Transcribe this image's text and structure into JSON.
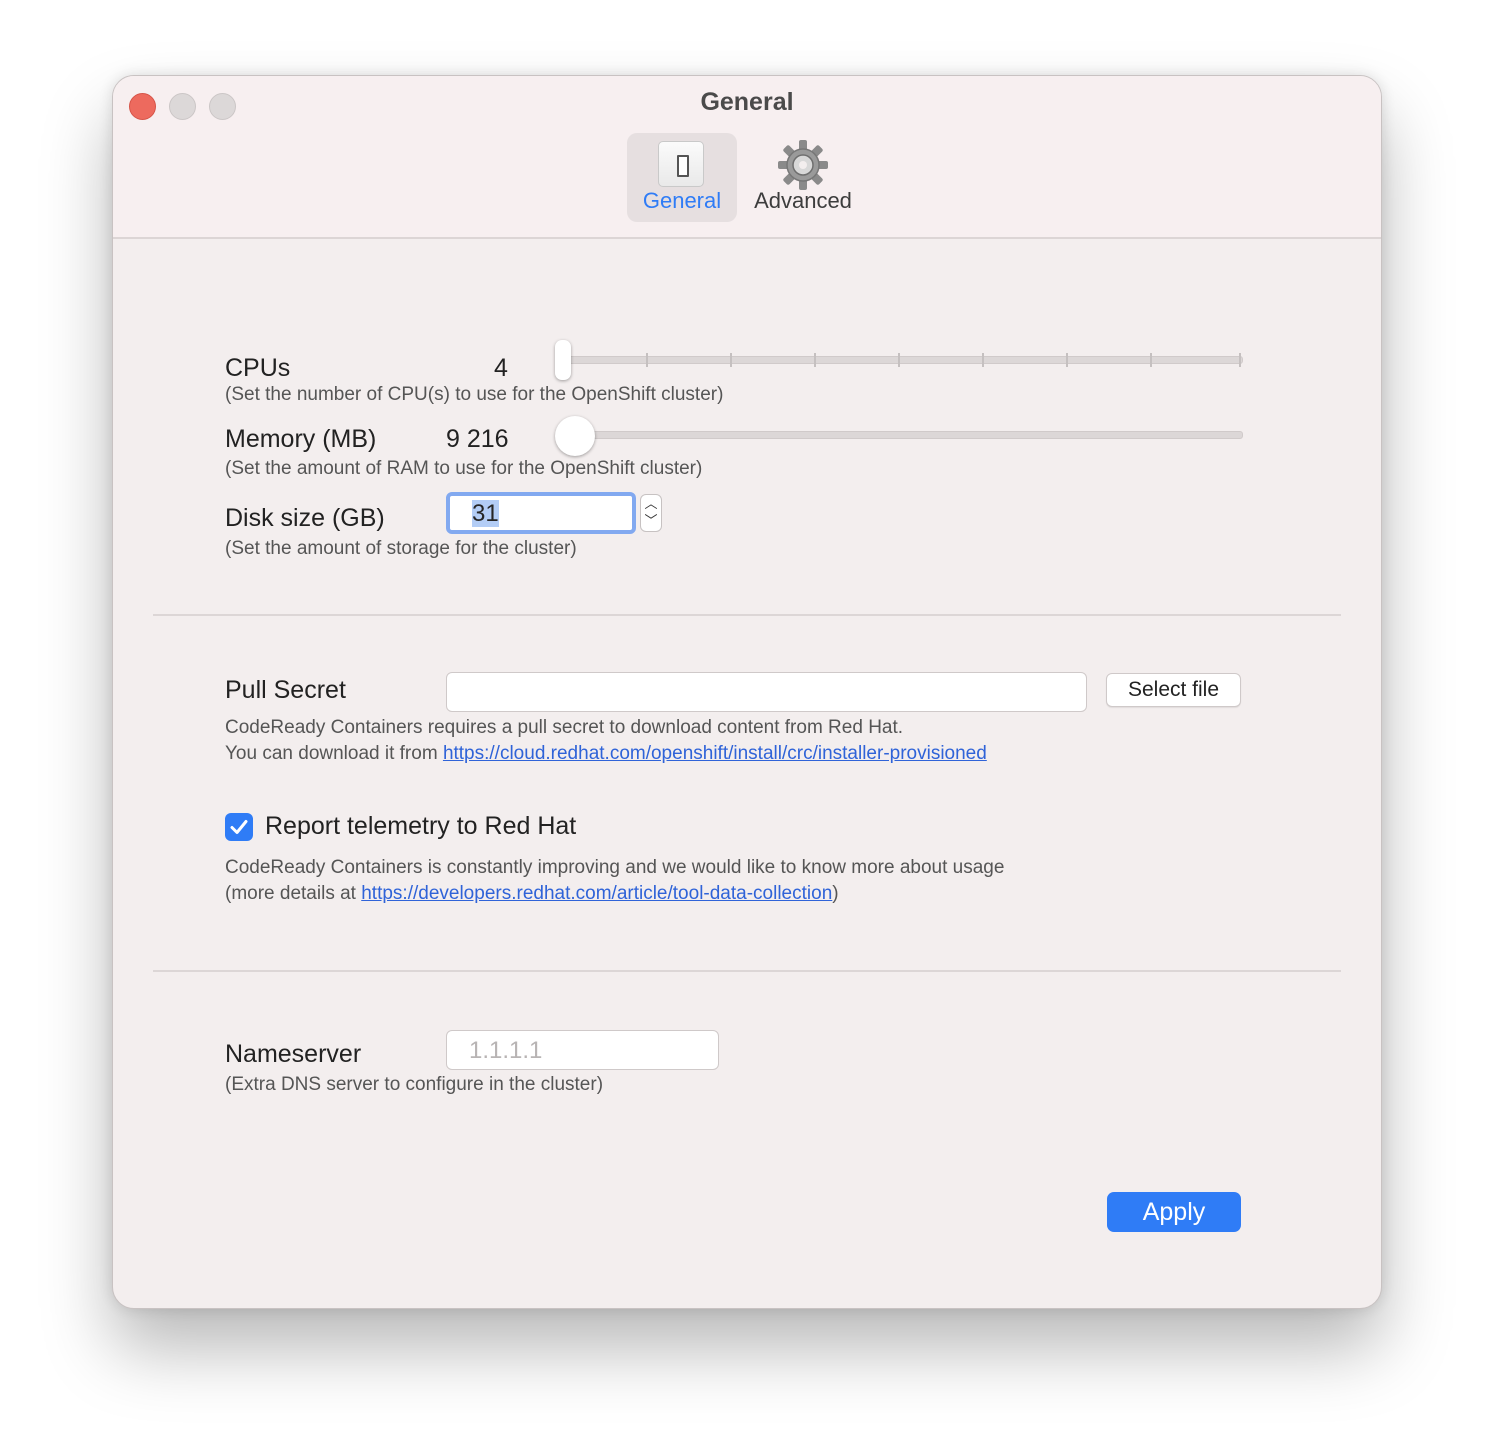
{
  "window": {
    "title": "General"
  },
  "toolbar": {
    "tabs": [
      {
        "label": "General",
        "icon": "switch-icon",
        "selected": true
      },
      {
        "label": "Advanced",
        "icon": "gear-icon",
        "selected": false
      }
    ]
  },
  "cpus": {
    "label": "CPUs",
    "value": "4",
    "hint": "(Set the number of CPU(s) to use for the OpenShift cluster)"
  },
  "memory": {
    "label": "Memory (MB)",
    "value": "9 216",
    "hint": "(Set the amount of RAM to use for the OpenShift cluster)"
  },
  "disk": {
    "label": "Disk size (GB)",
    "value": "31",
    "hint": "(Set the amount of storage for the cluster)"
  },
  "pull_secret": {
    "label": "Pull Secret",
    "value": "",
    "button_label": "Select file",
    "hint_line1": "CodeReady Containers requires a pull secret to download content from Red Hat.",
    "hint_line2_prefix": "You can download it from ",
    "hint_link": "https://cloud.redhat.com/openshift/install/crc/installer-provisioned"
  },
  "telemetry": {
    "label": "Report telemetry to Red Hat",
    "checked": true,
    "hint_line1": "CodeReady Containers is constantly improving and we would like to know more about usage",
    "hint_line2_prefix": "(more details at ",
    "hint_link": "https://developers.redhat.com/article/tool-data-collection",
    "hint_line2_suffix": ")"
  },
  "nameserver": {
    "label": "Nameserver",
    "placeholder": "1.1.1.1",
    "hint": "(Extra DNS server to configure in the cluster)"
  },
  "actions": {
    "apply_label": "Apply"
  },
  "colors": {
    "accent": "#2f7cf6",
    "close": "#ed6a5e",
    "link": "#2f63d8"
  }
}
